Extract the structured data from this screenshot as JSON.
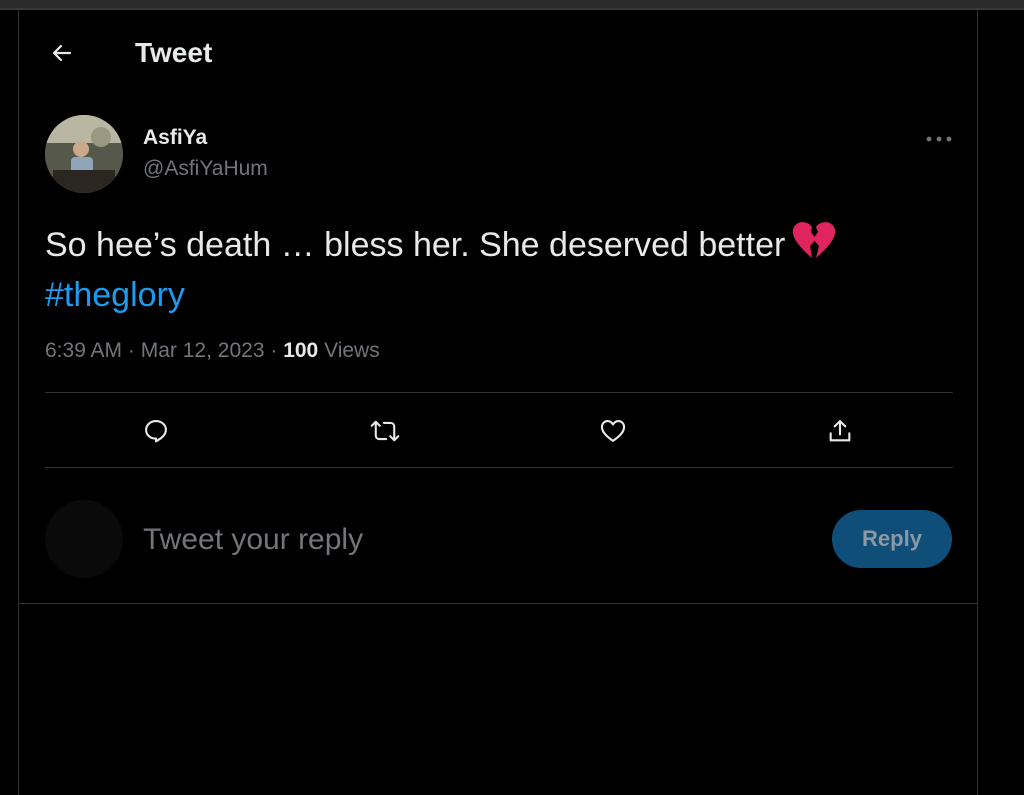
{
  "header": {
    "title": "Tweet"
  },
  "author": {
    "display_name": "AsfiYa",
    "handle": "@AsfiYaHum"
  },
  "tweet": {
    "text": "So hee’s death … bless her. She deserved better",
    "emoji": "broken-heart",
    "hashtag": "#theglory",
    "time": "6:39 AM",
    "date": "Mar 12, 2023",
    "separator": "·",
    "views_count": "100",
    "views_label": "Views"
  },
  "reply": {
    "placeholder": "Tweet your reply",
    "button_label": "Reply"
  },
  "colors": {
    "background": "#000000",
    "primary_text": "#e7e9ea",
    "secondary_text": "#71767b",
    "link": "#1d9bf0",
    "reply_button_bg": "#0f4e78",
    "emoji": "#e0245e"
  },
  "icons": [
    "back-arrow-icon",
    "more-icon",
    "reply-icon",
    "retweet-icon",
    "like-icon",
    "share-icon",
    "broken-heart-emoji"
  ]
}
